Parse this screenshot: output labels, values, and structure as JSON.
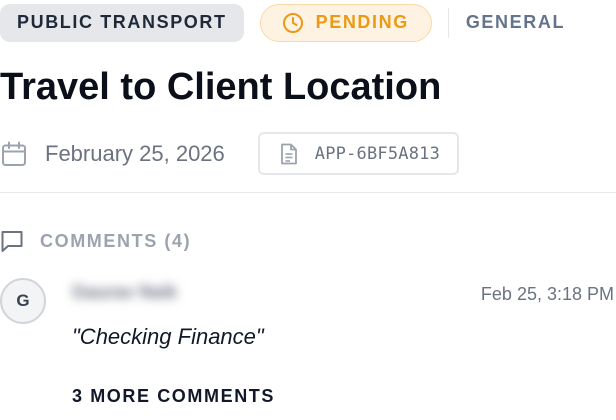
{
  "tags": {
    "category": "PUBLIC TRANSPORT",
    "status": "PENDING",
    "status_icon": "clock-icon",
    "type": "GENERAL"
  },
  "title": "Travel to Client Location",
  "meta": {
    "date": "February 25, 2026",
    "date_icon": "calendar-icon",
    "reference": "APP-6BF5A813",
    "reference_icon": "document-icon"
  },
  "comments": {
    "title": "COMMENTS (4)",
    "icon": "comment-icon",
    "items": [
      {
        "avatar_initial": "G",
        "author": "Gaurav Naik",
        "time": "Feb 25, 3:18 PM",
        "text": "\"Checking Finance\""
      }
    ],
    "more_label": "3 MORE COMMENTS"
  },
  "colors": {
    "status_text": "#ea9a14",
    "status_bg": "#fef3e2",
    "category_bg": "#e5e7eb",
    "muted_text": "#6b7280"
  }
}
